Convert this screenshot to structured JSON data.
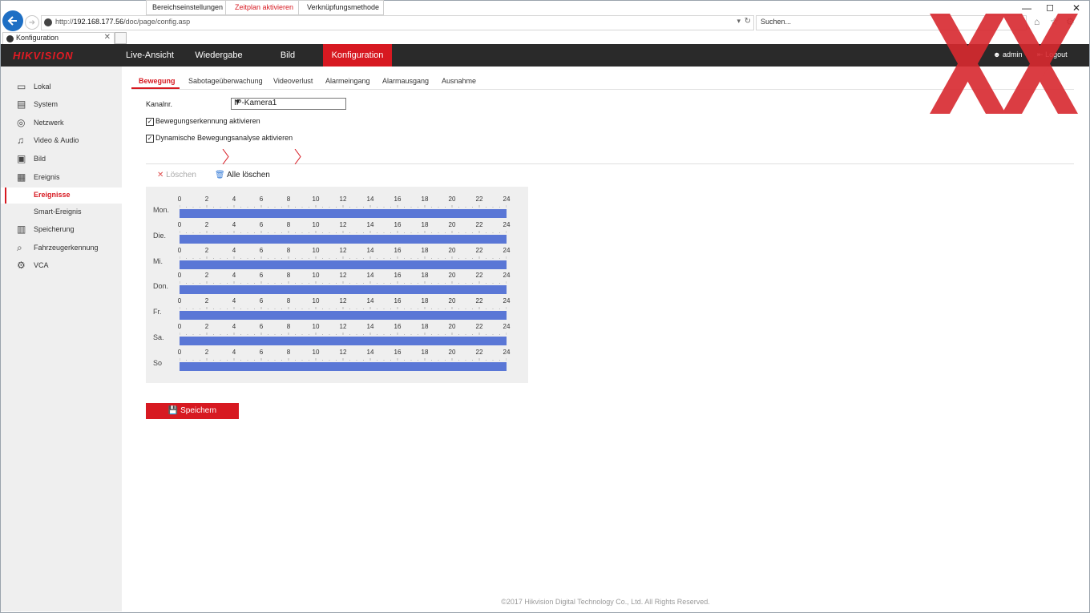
{
  "browser": {
    "url_prefix": "http://",
    "url_host": "192.168.177.56",
    "url_path": "/doc/page/config.asp",
    "search_placeholder": "Suchen...",
    "tab_title": "Konfiguration"
  },
  "header": {
    "logo": "HIKVISION",
    "nav": [
      "Live-Ansicht",
      "Wiedergabe",
      "Bild",
      "Konfiguration"
    ],
    "active_nav": "Konfiguration",
    "user": "admin",
    "logout": "Logout"
  },
  "sidebar": {
    "items": [
      {
        "label": "Lokal",
        "icon": "monitor-icon"
      },
      {
        "label": "System",
        "icon": "system-icon"
      },
      {
        "label": "Netzwerk",
        "icon": "globe-icon"
      },
      {
        "label": "Video & Audio",
        "icon": "video-audio-icon"
      },
      {
        "label": "Bild",
        "icon": "image-icon"
      },
      {
        "label": "Ereignis",
        "icon": "calendar-icon"
      },
      {
        "label": "Ereignisse",
        "sub": true,
        "active": true
      },
      {
        "label": "Smart-Ereignis",
        "sub": true
      },
      {
        "label": "Speicherung",
        "icon": "storage-icon"
      },
      {
        "label": "Fahrzeugerkennung",
        "icon": "vehicle-detect-icon"
      },
      {
        "label": "VCA",
        "icon": "vca-icon"
      }
    ]
  },
  "subtabs": [
    "Bewegung",
    "Sabotageüberwachung",
    "Videoverlust",
    "Alarmeingang",
    "Alarmausgang",
    "Ausnahme"
  ],
  "form": {
    "channel_label": "Kanalnr.",
    "channel_value": "IP-Kamera1",
    "motion_enable_label": "Bewegungserkennung aktivieren",
    "motion_enable_checked": true,
    "dynamic_label": "Dynamische Bewegungsanalyse aktivieren",
    "dynamic_checked": true
  },
  "steps": [
    "Bereichseinstellungen",
    "Zeitplan aktivieren",
    "Verknüpfungsmethode"
  ],
  "active_step": "Zeitplan aktivieren",
  "schedule": {
    "delete_label": "Löschen",
    "delete_all_label": "Alle löschen",
    "days": [
      "Mon.",
      "Die.",
      "Mi.",
      "Don.",
      "Fr.",
      "Sa.",
      "So"
    ],
    "ticks": [
      "0",
      "2",
      "4",
      "6",
      "8",
      "10",
      "12",
      "14",
      "16",
      "18",
      "20",
      "22",
      "24"
    ],
    "bars": [
      {
        "start": 0,
        "end": 24
      },
      {
        "start": 0,
        "end": 24
      },
      {
        "start": 0,
        "end": 24
      },
      {
        "start": 0,
        "end": 24
      },
      {
        "start": 0,
        "end": 24
      },
      {
        "start": 0,
        "end": 24
      },
      {
        "start": 0,
        "end": 24
      }
    ],
    "bar_color": "#5a77d6"
  },
  "save_label": "Speichern",
  "footer": "©2017 Hikvision Digital Technology Co., Ltd. All Rights Reserved.",
  "colors": {
    "accent": "#d71921",
    "header_bg": "#2a2a2a",
    "sidebar_bg": "#efefef"
  }
}
